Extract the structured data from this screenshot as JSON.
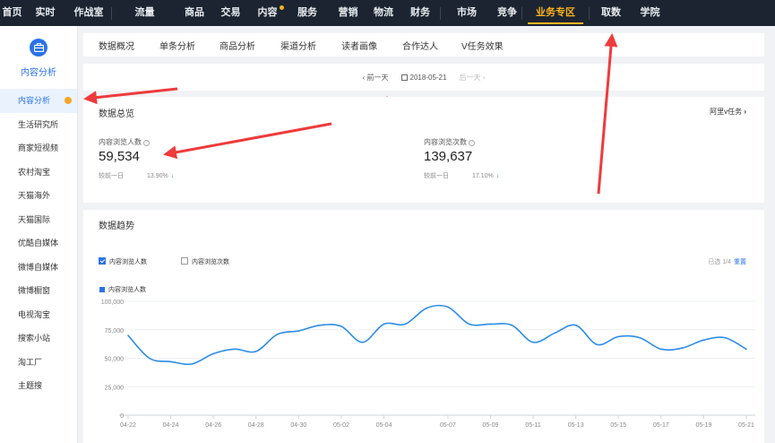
{
  "topnav": {
    "items": [
      "首页",
      "实时",
      "作战室",
      "流量",
      "商品",
      "交易",
      "内容",
      "服务",
      "营销",
      "物流",
      "财务",
      "市场",
      "竞争",
      "业务专区",
      "取数",
      "学院"
    ],
    "active_index": 13,
    "dot_index": 6
  },
  "sidebar": {
    "header_label": "内容分析",
    "items": [
      "内容分析",
      "生活研究所",
      "商家短视频",
      "农村淘宝",
      "天猫海外",
      "天猫国际",
      "优酷自媒体",
      "微博自媒体",
      "微博橱窗",
      "电视淘宝",
      "搜索小站",
      "淘工厂",
      "主题搜"
    ],
    "active_index": 0
  },
  "subtabs": [
    "数据概况",
    "单条分析",
    "商品分析",
    "渠道分析",
    "读者画像",
    "合作达人",
    "V任务效果"
  ],
  "datebar": {
    "prev": "前一天",
    "date": "2018-05-21",
    "next": "后一天"
  },
  "overview": {
    "title": "数据总览",
    "link": "阿里v任务",
    "metrics": [
      {
        "label": "内容浏览人数",
        "value": "59,534",
        "compare_label": "较前一日",
        "compare_pct": "13.90%"
      },
      {
        "label": "内容浏览次数",
        "value": "139,637",
        "compare_label": "较前一日",
        "compare_pct": "17.10%"
      }
    ]
  },
  "trend": {
    "title": "数据趋势",
    "checkbox_views_people": "内容浏览人数",
    "checkbox_views_count": "内容浏览次数",
    "selected": "已选 1/4",
    "reset": "重置"
  },
  "chart_data": {
    "type": "line",
    "title": "",
    "xlabel": "",
    "ylabel": "",
    "ylim": [
      0,
      100000
    ],
    "yticks": [
      0,
      25000,
      50000,
      75000,
      100000
    ],
    "ytick_labels": [
      "0",
      "25,000",
      "50,000",
      "75,000",
      "100,000"
    ],
    "xtick_labels": [
      "04-22",
      "04-24",
      "04-26",
      "04-28",
      "04-30",
      "05-02",
      "05-04",
      "05-07",
      "05-09",
      "05-11",
      "05-13",
      "05-15",
      "05-17",
      "05-19",
      "05-21"
    ],
    "x": [
      "04-22",
      "04-23",
      "04-24",
      "04-25",
      "04-26",
      "04-27",
      "04-28",
      "04-29",
      "04-30",
      "05-01",
      "05-02",
      "05-03",
      "05-04",
      "05-05",
      "05-06",
      "05-07",
      "05-08",
      "05-09",
      "05-10",
      "05-11",
      "05-12",
      "05-13",
      "05-14",
      "05-15",
      "05-16",
      "05-17",
      "05-18",
      "05-19",
      "05-20",
      "05-21"
    ],
    "series": [
      {
        "name": "内容浏览人数",
        "color": "#2b8ce8",
        "values": [
          70000,
          50000,
          47000,
          45000,
          54000,
          58000,
          56000,
          71000,
          74000,
          79000,
          78000,
          64000,
          80000,
          80000,
          94000,
          95000,
          80000,
          80000,
          79000,
          64000,
          72000,
          79000,
          62000,
          69000,
          68000,
          58000,
          59000,
          66000,
          68000,
          58000
        ]
      }
    ],
    "grid": true,
    "legend": "top-left"
  }
}
